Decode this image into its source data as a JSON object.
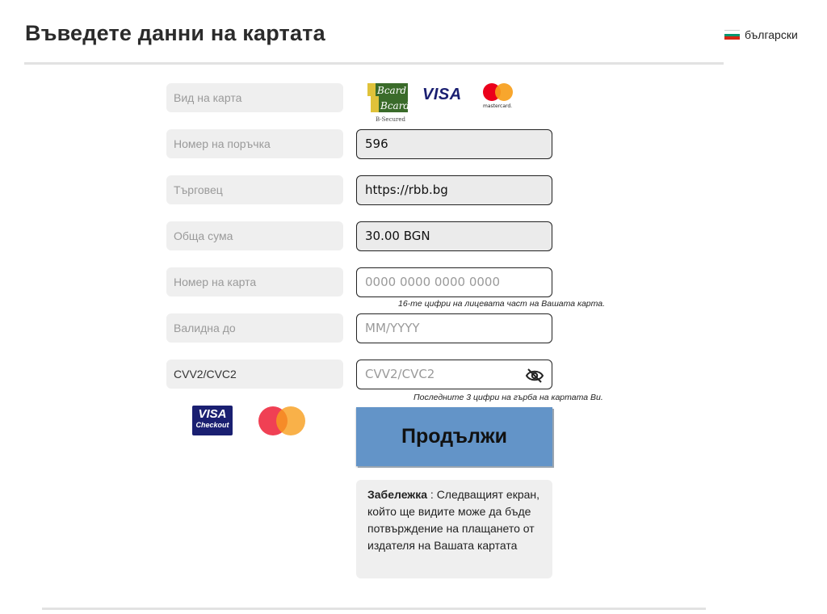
{
  "page": {
    "title": "Въведете данни на картата"
  },
  "language": {
    "label": "български",
    "flag_colors": [
      "#ffffff",
      "#00966e",
      "#d62612"
    ]
  },
  "card_type": {
    "label": "Вид на карта",
    "bcard_caption": "B-Secured",
    "bcard_line1": "Bcard",
    "bcard_line2": "Bcard",
    "visa_text": "VISA",
    "mastercard_text": "mastercard."
  },
  "fields": {
    "order": {
      "label": "Номер на поръчка",
      "value": "596"
    },
    "merchant": {
      "label": "Търговец",
      "value": "https://rbb.bg"
    },
    "amount": {
      "label": "Обща сума",
      "value": "30.00 BGN"
    },
    "card_number": {
      "label": "Номер на карта",
      "placeholder": "0000 0000 0000 0000",
      "hint": "16-те цифри на лицевата част на Вашата карта."
    },
    "expiry": {
      "label": "Валидна до",
      "placeholder": "MM/YYYY"
    },
    "cvv": {
      "label": "CVV2/CVC2",
      "placeholder": "CVV2/CVC2",
      "hint": "Последните 3 цифри на гърба на картата Ви."
    }
  },
  "badges": {
    "visa_checkout_line1": "VISA",
    "visa_checkout_line2": "Checkout"
  },
  "submit": {
    "label": "Продължи"
  },
  "note": {
    "heading": "Забележка",
    "text": " : Следващият екран, който ще видите може да бъде потвърждение на плащането от издателя на Вашата картата"
  },
  "colors": {
    "button": "#6394c8",
    "label_bg": "#efefef",
    "readonly_bg": "#ebebeb"
  }
}
